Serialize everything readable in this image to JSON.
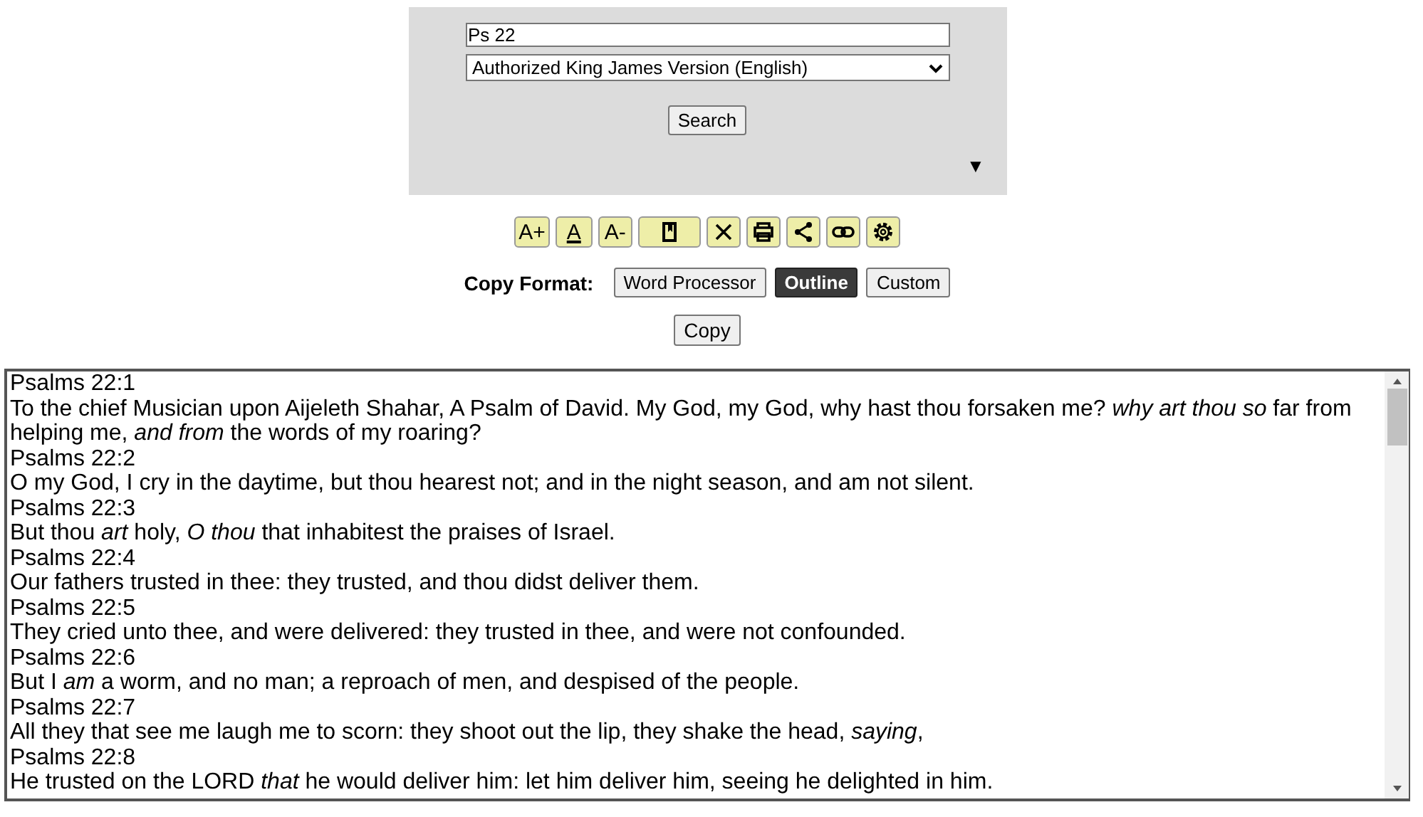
{
  "search": {
    "value": "Ps 22",
    "version": "Authorized King James Version (English)",
    "button": "Search",
    "toggle": "▼"
  },
  "toolbar": [
    {
      "kind": "text",
      "label": "A+"
    },
    {
      "kind": "underline",
      "label": "A"
    },
    {
      "kind": "text",
      "label": "A-"
    },
    {
      "kind": "book"
    },
    {
      "kind": "close"
    },
    {
      "kind": "print"
    },
    {
      "kind": "share"
    },
    {
      "kind": "link"
    },
    {
      "kind": "settings"
    }
  ],
  "copy_format": {
    "label": "Copy Format:",
    "options": [
      {
        "label": "Word Processor",
        "selected": false
      },
      {
        "label": "Outline",
        "selected": true
      },
      {
        "label": "Custom",
        "selected": false
      }
    ]
  },
  "copy_button": "Copy",
  "verses": [
    {
      "ref": "Psalms 22:1",
      "text": "To the chief Musician upon Aijeleth Shahar, A Psalm of David. My God, my God, why hast thou forsaken me? *why art thou so* far from helping me, *and from* the words of my roaring?"
    },
    {
      "ref": "Psalms 22:2",
      "text": "O my God, I cry in the daytime, but thou hearest not; and in the night season, and am not silent."
    },
    {
      "ref": "Psalms 22:3",
      "text": "But thou *art* holy, *O thou* that inhabitest the praises of Israel."
    },
    {
      "ref": "Psalms 22:4",
      "text": "Our fathers trusted in thee: they trusted, and thou didst deliver them."
    },
    {
      "ref": "Psalms 22:5",
      "text": "They cried unto thee, and were delivered: they trusted in thee, and were not confounded."
    },
    {
      "ref": "Psalms 22:6",
      "text": "But I *am* a worm, and no man; a reproach of men, and despised of the people."
    },
    {
      "ref": "Psalms 22:7",
      "text": "All they that see me laugh me to scorn: they shoot out the lip, they shake the head, *saying*,"
    },
    {
      "ref": "Psalms 22:8",
      "text": "He trusted on the LORD *that* he would deliver him: let him deliver him, seeing he delighted in him."
    }
  ]
}
